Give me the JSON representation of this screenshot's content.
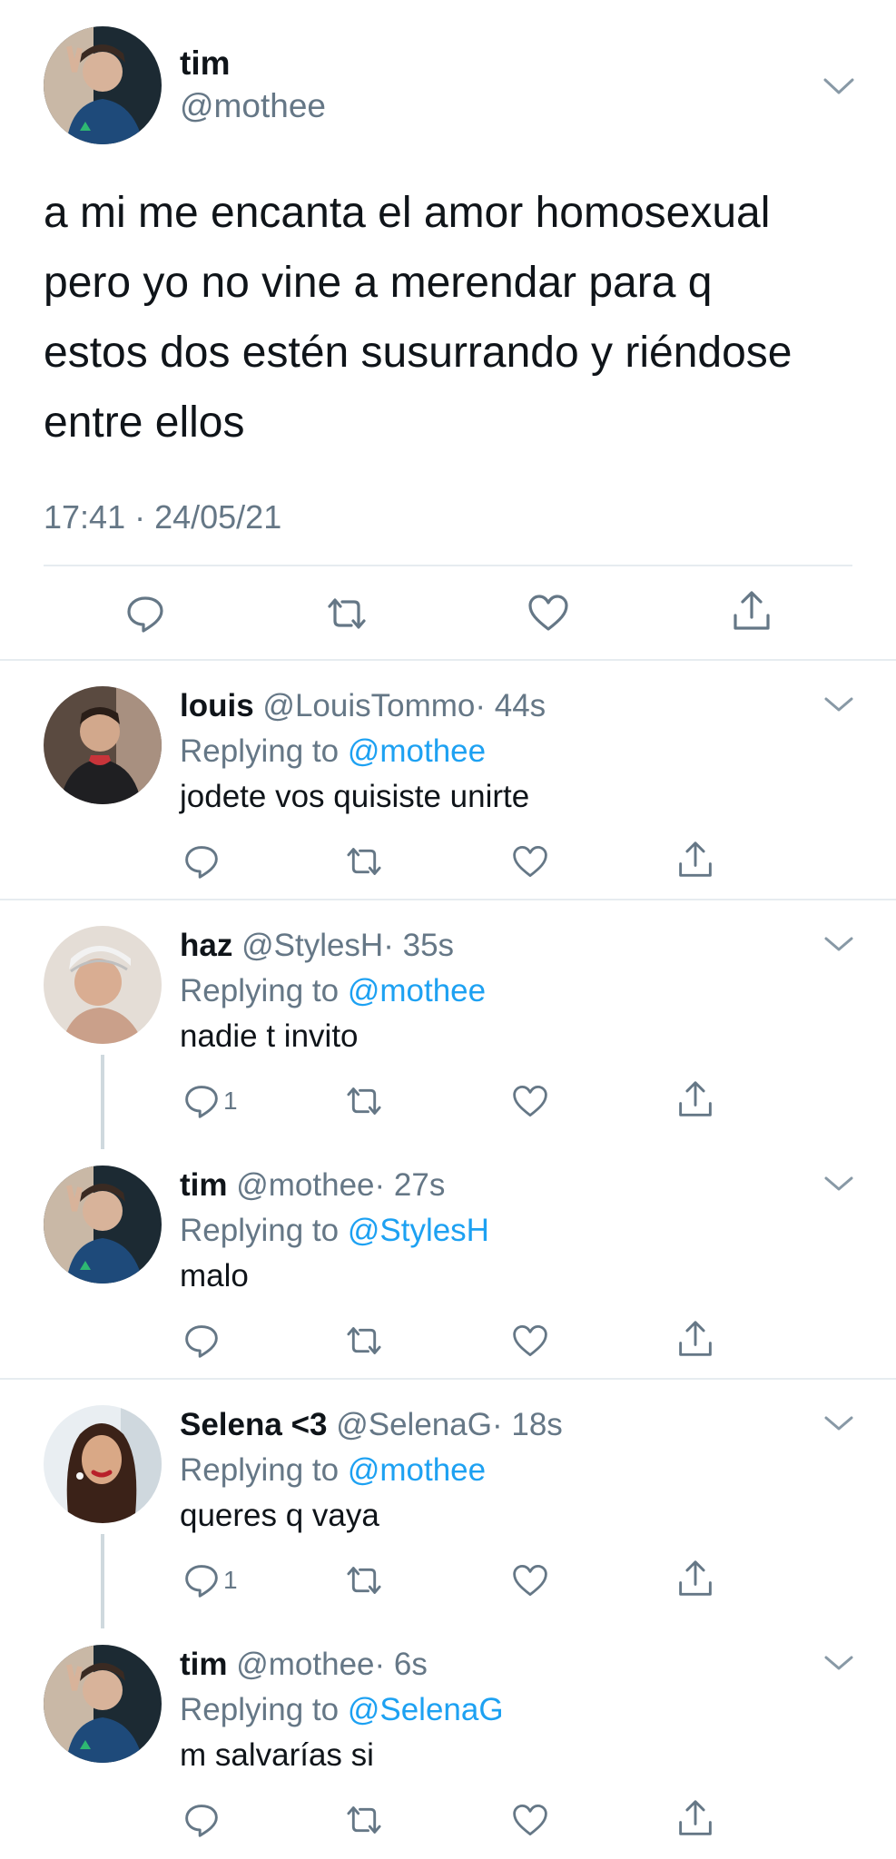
{
  "main_tweet": {
    "name": "tim",
    "handle": "@mothee",
    "text": "a mi me encanta el amor homosexual\npero yo no vine a merendar para q\nestos dos estén susurrando y riéndose\nentre ellos",
    "timestamp": "17:41 · 24/05/21"
  },
  "replies": [
    {
      "name": "louis",
      "handle": "@LouisTommo",
      "time": "· 44s",
      "replying_label": "Replying to",
      "replying_to": "@mothee",
      "text": "jodete vos quisiste unirte",
      "reply_count": ""
    },
    {
      "name": "haz",
      "handle": "@StylesH",
      "time": "· 35s",
      "replying_label": "Replying to",
      "replying_to": "@mothee",
      "text": "nadie t invito",
      "reply_count": "1"
    },
    {
      "name": "tim",
      "handle": "@mothee",
      "time": "· 27s",
      "replying_label": "Replying to",
      "replying_to": "@StylesH",
      "text": "malo",
      "reply_count": ""
    },
    {
      "name": "Selena <3",
      "handle": "@SelenaG",
      "time": "· 18s",
      "replying_label": "Replying to",
      "replying_to": "@mothee",
      "text": "queres q vaya",
      "reply_count": "1"
    },
    {
      "name": "tim",
      "handle": "@mothee",
      "time": "· 6s",
      "replying_label": "Replying to",
      "replying_to": "@SelenaG",
      "text": "m salvarías si",
      "reply_count": ""
    }
  ],
  "colors": {
    "link": "#1da1f2",
    "secondary": "#657786",
    "divider": "#e6ecf0",
    "thread_line": "#cfd9de"
  },
  "icons": [
    "reply-icon",
    "retweet-icon",
    "like-icon",
    "share-icon",
    "chevron-down-icon"
  ]
}
